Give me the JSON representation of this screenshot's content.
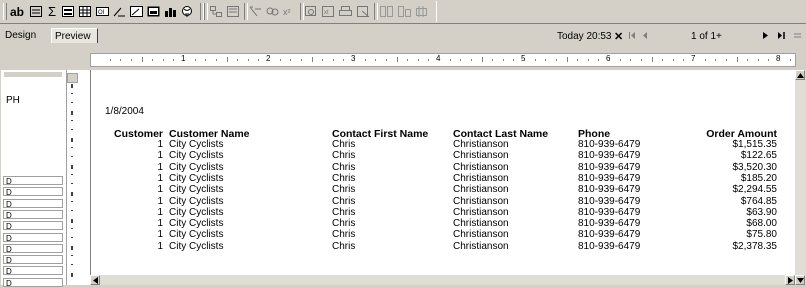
{
  "toolbar": {
    "ab_label": "ab",
    "sigma_label": "Σ"
  },
  "tabs": {
    "design": "Design",
    "preview": "Preview"
  },
  "nav": {
    "today": "Today 20:53",
    "close": "✕",
    "page": "1 of 1+"
  },
  "ruler_numbers": [
    "1",
    "2",
    "3",
    "4",
    "5",
    "6",
    "7",
    "8"
  ],
  "sections": {
    "ph": "PH",
    "d": "D"
  },
  "report": {
    "date": "1/8/2004",
    "headers": [
      "Customer",
      "Customer Name",
      "Contact First Name",
      "Contact Last Name",
      "Phone",
      "Order Amount"
    ],
    "rows": [
      [
        "1",
        "City Cyclists",
        "Chris",
        "Christianson",
        "810-939-6479",
        "$1,515.35"
      ],
      [
        "1",
        "City Cyclists",
        "Chris",
        "Christianson",
        "810-939-6479",
        "$122.65"
      ],
      [
        "1",
        "City Cyclists",
        "Chris",
        "Christianson",
        "810-939-6479",
        "$3,520.30"
      ],
      [
        "1",
        "City Cyclists",
        "Chris",
        "Christianson",
        "810-939-6479",
        "$185.20"
      ],
      [
        "1",
        "City Cyclists",
        "Chris",
        "Christianson",
        "810-939-6479",
        "$2,294.55"
      ],
      [
        "1",
        "City Cyclists",
        "Chris",
        "Christianson",
        "810-939-6479",
        "$764.85"
      ],
      [
        "1",
        "City Cyclists",
        "Chris",
        "Christianson",
        "810-939-6479",
        "$63.90"
      ],
      [
        "1",
        "City Cyclists",
        "Chris",
        "Christianson",
        "810-939-6479",
        "$68.00"
      ],
      [
        "1",
        "City Cyclists",
        "Chris",
        "Christianson",
        "810-939-6479",
        "$75.80"
      ],
      [
        "1",
        "City Cyclists",
        "Chris",
        "Christianson",
        "810-939-6479",
        "$2,378.35"
      ]
    ]
  }
}
